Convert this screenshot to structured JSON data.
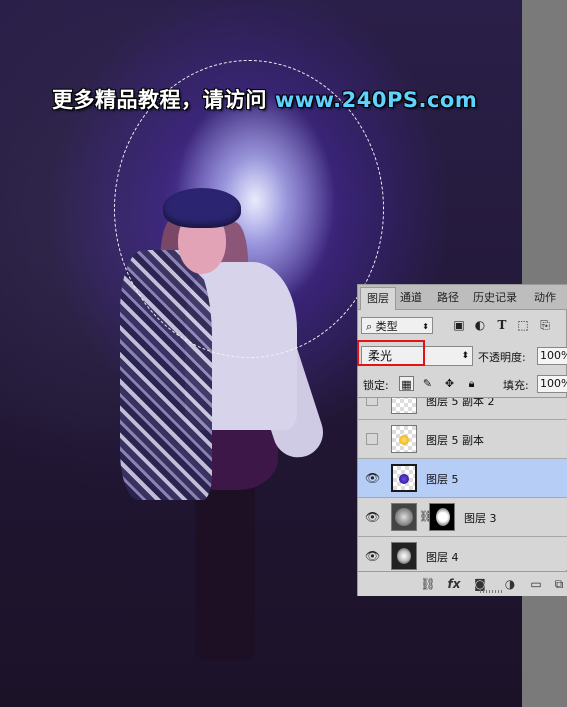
{
  "watermark": {
    "text_cn": "更多精品教程，请访问",
    "url": "www.240PS.com"
  },
  "colors": {
    "url_color": "#5fd2ff",
    "selected_layer_bg": "#b6cdf6",
    "highlight_border": "#e41212",
    "panel_bg": "#d6d6d6"
  },
  "panel": {
    "tabs": [
      "图层",
      "通道",
      "路径",
      "历史记录",
      "动作"
    ],
    "filter": {
      "label": "类型",
      "icons": [
        "image-filter-icon",
        "adjustment-filter-icon",
        "type-filter-icon",
        "shape-filter-icon",
        "smart-object-filter-icon"
      ],
      "type_glyph": "T"
    },
    "blend_mode": "柔光",
    "opacity_label": "不透明度:",
    "opacity_value": "100%",
    "lock_label": "锁定:",
    "fill_label": "填充:",
    "fill_value": "100%",
    "layers": [
      {
        "name": "图层 5 副本 2",
        "visible": false,
        "thumb": "transparent"
      },
      {
        "name": "图层 5 副本",
        "visible": false,
        "thumb": "yellow-dot"
      },
      {
        "name": "图层 5",
        "visible": true,
        "thumb": "purple-dot",
        "selected": true
      },
      {
        "name": "图层 3",
        "visible": true,
        "thumb": "cloud",
        "has_mask": true
      },
      {
        "name": "图层 4",
        "visible": true,
        "thumb": "blob"
      }
    ],
    "bottom_icons": [
      "link-layers-icon",
      "fx-icon",
      "add-mask-icon",
      "adjustment-layer-icon",
      "new-group-icon",
      "new-layer-icon"
    ],
    "fx_label": "fx"
  }
}
